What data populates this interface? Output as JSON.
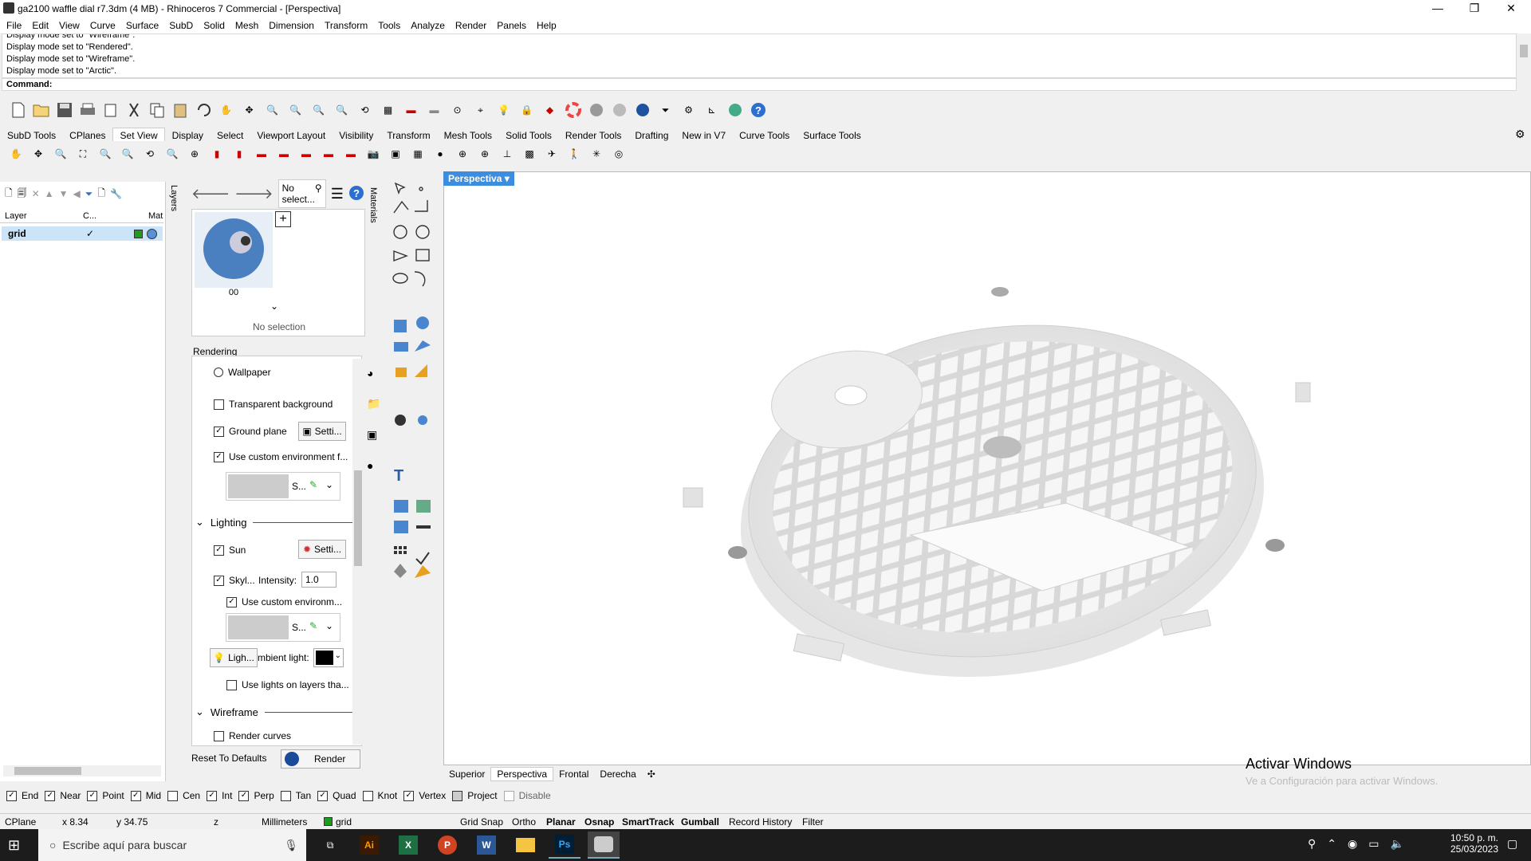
{
  "window": {
    "title": "ga2100 waffle dial r7.3dm (4 MB) - Rhinoceros 7 Commercial - [Perspectiva]",
    "minimize": "—",
    "restore": "❐",
    "close": "✕"
  },
  "menu": [
    "File",
    "Edit",
    "View",
    "Curve",
    "Surface",
    "SubD",
    "Solid",
    "Mesh",
    "Dimension",
    "Transform",
    "Tools",
    "Analyze",
    "Render",
    "Panels",
    "Help"
  ],
  "command": {
    "history": [
      "Display mode set to \"Wireframe\".",
      "Display mode set to \"Rendered\".",
      "Display mode set to \"Wireframe\".",
      "Display mode set to \"Arctic\"."
    ],
    "prompt": "Command:"
  },
  "toolbar_tabs": [
    "SubD Tools",
    "CPlanes",
    "Set View",
    "Display",
    "Select",
    "Viewport Layout",
    "Visibility",
    "Transform",
    "Mesh Tools",
    "Solid Tools",
    "Render Tools",
    "Drafting",
    "New in V7",
    "Curve Tools",
    "Surface Tools"
  ],
  "toolbar_tabs_active": "Set View",
  "layers": {
    "tab": "Layers",
    "headers": [
      "Layer",
      "C...",
      "Mat"
    ],
    "rows": [
      {
        "name": "grid",
        "check": "✓"
      }
    ]
  },
  "materials": {
    "tab": "Materials",
    "filter": "No select...",
    "thumb_label": "00",
    "no_selection": "No selection"
  },
  "rendering": {
    "title": "Rendering",
    "wallpaper": "Wallpaper",
    "transparent_bg": "Transparent background",
    "ground_plane": "Ground plane",
    "settings_short": "Setti...",
    "custom_env": "Use custom environment f...",
    "env_s": "S...",
    "lighting": "Lighting",
    "sun": "Sun",
    "skylight": "Skyl...",
    "intensity_label": "Intensity:",
    "intensity_value": "1.0",
    "use_custom_env": "Use custom environm...",
    "lights_btn": "Ligh...",
    "ambient": "mbient light:",
    "lights_on_layers": "Use lights on layers tha...",
    "wireframe": "Wireframe",
    "render_curves": "Render curves",
    "reset": "Reset To Defaults",
    "render": "Render"
  },
  "viewport": {
    "name": "Perspectiva",
    "tabs": [
      "Superior",
      "Perspectiva",
      "Frontal",
      "Derecha"
    ],
    "active": "Perspectiva",
    "watermark_title": "Activar Windows",
    "watermark_sub": "Ve a Configuración para activar Windows."
  },
  "osnaps": [
    {
      "label": "End",
      "on": true
    },
    {
      "label": "Near",
      "on": true
    },
    {
      "label": "Point",
      "on": true
    },
    {
      "label": "Mid",
      "on": true
    },
    {
      "label": "Cen",
      "on": false
    },
    {
      "label": "Int",
      "on": true
    },
    {
      "label": "Perp",
      "on": true
    },
    {
      "label": "Tan",
      "on": false
    },
    {
      "label": "Quad",
      "on": true
    },
    {
      "label": "Knot",
      "on": false
    },
    {
      "label": "Vertex",
      "on": true
    },
    {
      "label": "Project",
      "on": false
    },
    {
      "label": "Disable",
      "on": false
    }
  ],
  "status": {
    "cplane": "CPlane",
    "x": "x 8.34",
    "y": "y 34.75",
    "z": "z",
    "units": "Millimeters",
    "layer": "grid",
    "grid_snap": "Grid Snap",
    "ortho": "Ortho",
    "planar": "Planar",
    "osnap": "Osnap",
    "smarttrack": "SmartTrack",
    "gumball": "Gumball",
    "record": "Record History",
    "filter": "Filter"
  },
  "taskbar": {
    "search": "Escribe aquí para buscar",
    "time": "10:50 p. m.",
    "date": "25/03/2023"
  },
  "colors": {
    "accent": "#3c8dde",
    "layer_color": "#1c9e1c",
    "taskbar": "#1c1c1c"
  }
}
